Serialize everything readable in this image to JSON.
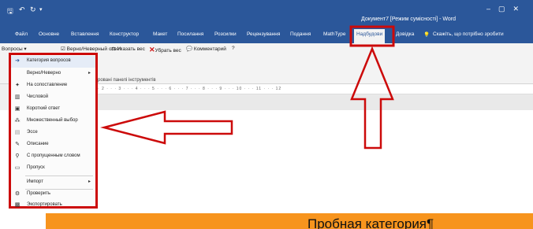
{
  "titlebar": {
    "title": "Документ7 [Режим сумісності] - Word",
    "save_icon": "save-icon",
    "undo_icon": "undo-icon",
    "redo_icon": "redo-icon"
  },
  "tabs": [
    "Файл",
    "Основне",
    "Вставлення",
    "Конструктор",
    "Макет",
    "Посилання",
    "Розсилки",
    "Рецензування",
    "Подання",
    "MathType",
    "Надбудови",
    "Довідка"
  ],
  "tellme": "Скажіть, що потрібно зробити",
  "ribbon": {
    "questions_btn": "Вопросы",
    "truefalse_btn": "Верно/Неверный ответ",
    "set_weight_btn": "Указать вес",
    "remove_weight_btn": "Убрать вес",
    "comment_btn": "Комментарий",
    "group_label": "ровані панелі інструментів"
  },
  "ruler_numbers": "· 2 · · · 3 · · · 4 · · · 5 · · · 6 · · · 7 · · · 8 · · · 9 · · · 10 · · · 11 · · · 12",
  "menu": {
    "items": [
      {
        "label": "Категория вопросов",
        "icon": "arrow-right-icon"
      },
      {
        "label": "Верно/Неверно",
        "icon": "",
        "submenu": true
      },
      {
        "label": "На сопоставление",
        "icon": "pin-icon"
      },
      {
        "label": "Числовой",
        "icon": "numeric-icon"
      },
      {
        "label": "Короткий ответ",
        "icon": "short-answer-icon"
      },
      {
        "label": "Множественный выбор",
        "icon": "multiple-choice-icon"
      },
      {
        "label": "Эссе",
        "icon": "essay-icon"
      },
      {
        "label": "Описание",
        "icon": "description-icon"
      },
      {
        "label": "С пропущенным словом",
        "icon": "missing-word-icon"
      },
      {
        "label": "Пропуск",
        "icon": "skip-icon"
      },
      {
        "label": "Импорт",
        "icon": "",
        "submenu": true
      },
      {
        "label": "Проверить",
        "icon": "check-icon"
      },
      {
        "label": "Экспортировать",
        "icon": "export-icon"
      }
    ]
  },
  "document": {
    "heading": "Пробная категория¶"
  },
  "colors": {
    "word_blue": "#2b579a",
    "highlight_red": "#cc0a0a",
    "heading_orange": "#f7941d"
  }
}
